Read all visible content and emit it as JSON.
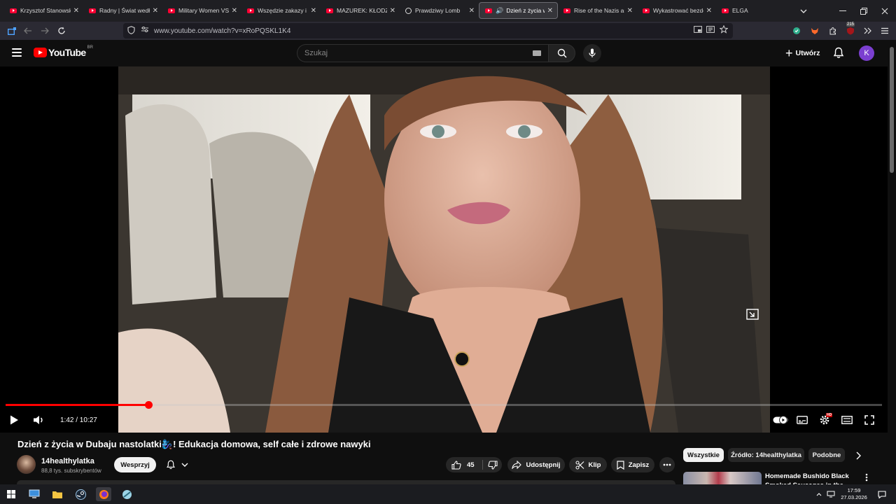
{
  "browser": {
    "tabs": [
      {
        "title": "Krzysztof Stanowski. ",
        "active": false
      },
      {
        "title": "Radny | Świat według",
        "active": false
      },
      {
        "title": "Military Women VS S",
        "active": false
      },
      {
        "title": "Wszędzie zakazy i pr",
        "active": false
      },
      {
        "title": "MAZUREK: KŁODZKO",
        "active": false
      },
      {
        "title": "Prawdziwy Lomb",
        "active": false
      },
      {
        "title": "Dzień z życia w D",
        "active": true
      },
      {
        "title": "Rise of the Nazis and",
        "active": false
      },
      {
        "title": "Wykastrować bezdom",
        "active": false
      },
      {
        "title": "ELGA",
        "active": false
      }
    ],
    "url": "www.youtube.com/watch?v=xRoPQSKL1K4",
    "extension_badge": "215"
  },
  "youtube": {
    "logo_text": "YouTube",
    "country_code": "BR",
    "search_placeholder": "Szukaj",
    "create_label": "Utwórz",
    "avatar_letter": "K",
    "accent": "#ff0000"
  },
  "player": {
    "current_time": "1:42",
    "duration": "10:27",
    "time_display": "1:42 / 10:27",
    "progress_fraction": 0.163,
    "settings_badge": "HD"
  },
  "video": {
    "title": "Dzień z życia w Dubaju nastolatki🧞‍♀️! Edukacja domowa, self całe i zdrowe nawyki",
    "channel_name": "14healthylatka",
    "subscribers": "88,8 tys. subskrybentów",
    "support_label": "Wesprzyj",
    "likes": "45",
    "share_label": "Udostępnij",
    "clip_label": "Klip",
    "save_label": "Zapisz"
  },
  "sidebar": {
    "chips": [
      "Wszystkie",
      "Źródło: 14healthylatka",
      "Podobne"
    ],
    "recommendation_title": "Homemade Bushido Black Smoked Sausages in the"
  },
  "taskbar": {
    "time": "17:59",
    "date": "27.03.2026"
  }
}
